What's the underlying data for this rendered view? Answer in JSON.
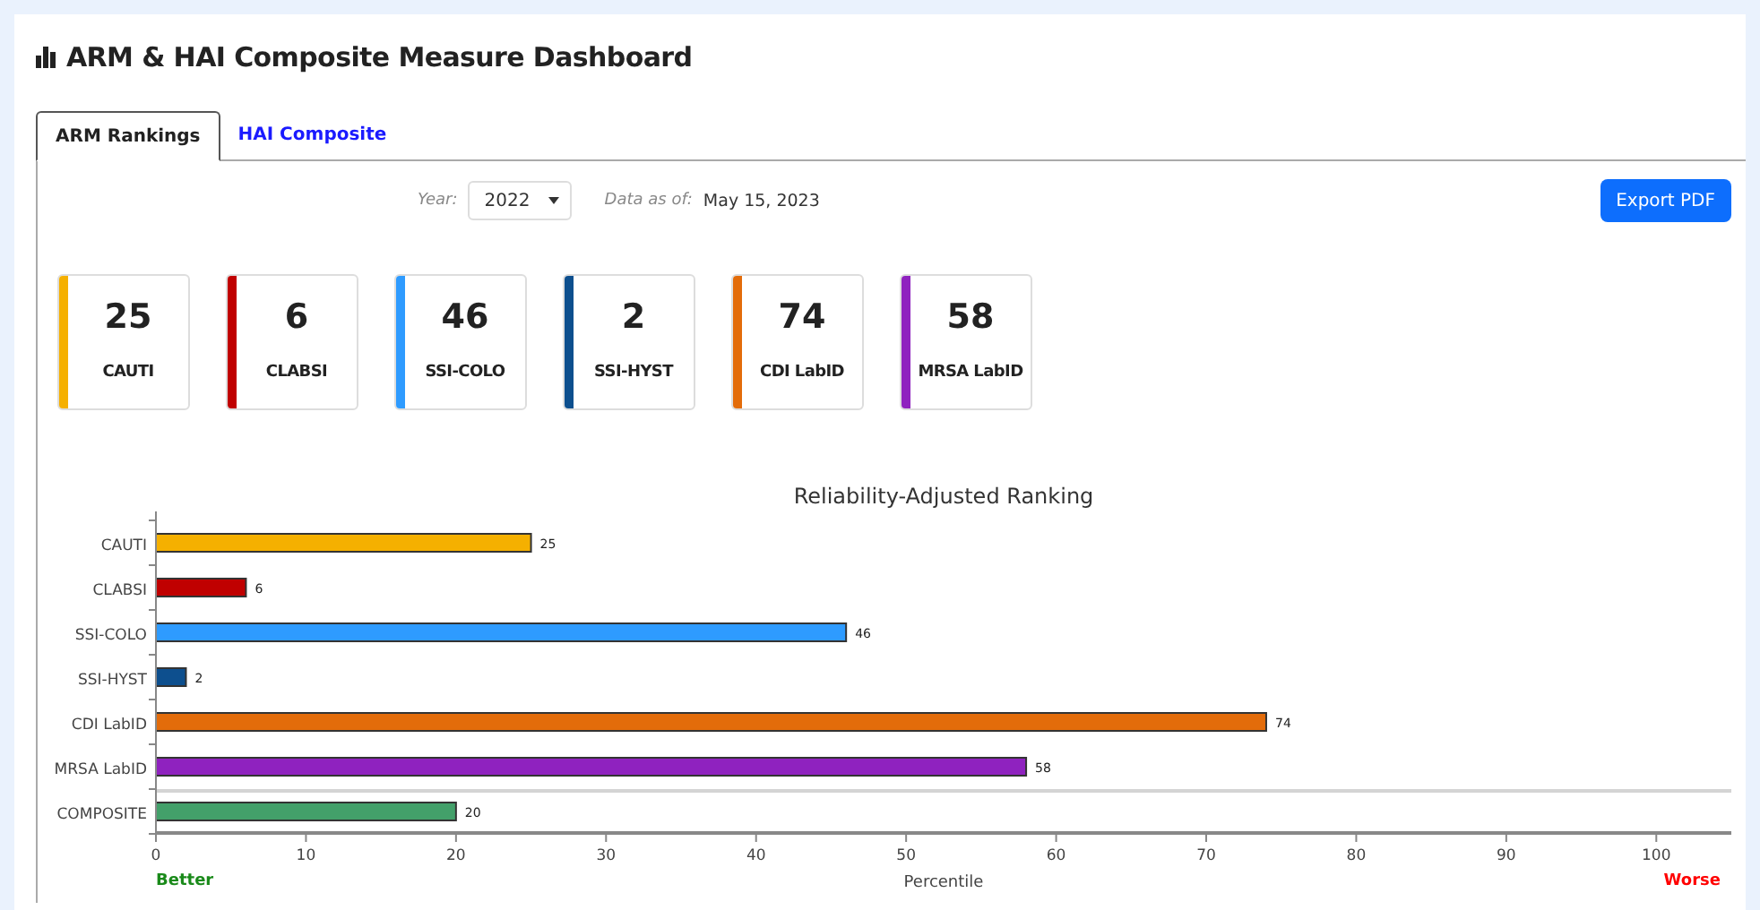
{
  "header": {
    "title": "ARM & HAI Composite Measure Dashboard"
  },
  "tabs": [
    {
      "label": "ARM Rankings",
      "selected": true
    },
    {
      "label": "HAI Composite",
      "selected": false
    }
  ],
  "toolbar": {
    "year_label": "Year:",
    "year_value": "2022",
    "data_as_of_label": "Data as of:",
    "data_as_of_value": "May 15, 2023",
    "export_button": "Export PDF"
  },
  "cards": [
    {
      "value": "25",
      "label": "CAUTI",
      "color": "#f5b000"
    },
    {
      "value": "6",
      "label": "CLABSI",
      "color": "#c00000"
    },
    {
      "value": "46",
      "label": "SSI-COLO",
      "color": "#2e9bff"
    },
    {
      "value": "2",
      "label": "SSI-HYST",
      "color": "#0d4f8e"
    },
    {
      "value": "74",
      "label": "CDI LabID",
      "color": "#e36c0a"
    },
    {
      "value": "58",
      "label": "MRSA LabID",
      "color": "#8f22bf"
    }
  ],
  "chart": {
    "chart_data": {
      "type": "bar",
      "orientation": "horizontal",
      "stacked": true,
      "title": "Reliability-Adjusted Ranking",
      "xlabel": "Percentile",
      "categories": [
        "CAUTI",
        "CLABSI",
        "SSI-COLO",
        "SSI-HYST",
        "CDI LabID",
        "MRSA LabID",
        "COMPOSITE"
      ],
      "series": [
        {
          "color": "#f5b000",
          "values": [
            25,
            null,
            null,
            null,
            null,
            null,
            null
          ]
        },
        {
          "color": "#c00000",
          "values": [
            null,
            6,
            null,
            null,
            null,
            null,
            null
          ]
        },
        {
          "color": "#2e9bff",
          "values": [
            null,
            null,
            46,
            null,
            null,
            null,
            null
          ]
        },
        {
          "color": "#0d4f8e",
          "values": [
            null,
            null,
            null,
            2,
            null,
            null,
            null
          ]
        },
        {
          "color": "#e36c0a",
          "values": [
            null,
            null,
            null,
            null,
            74,
            null,
            null
          ]
        },
        {
          "color": "#8f22bf",
          "values": [
            null,
            null,
            null,
            null,
            null,
            58,
            null
          ]
        },
        {
          "color": "#43a06a",
          "values": [
            null,
            null,
            null,
            null,
            null,
            null,
            20
          ]
        }
      ],
      "xlim": [
        0,
        105
      ],
      "xticks": [
        0,
        10,
        20,
        30,
        40,
        50,
        60,
        70,
        80,
        90,
        100
      ],
      "data_labels": true,
      "annotations": [
        "Better",
        "Worse"
      ]
    }
  }
}
